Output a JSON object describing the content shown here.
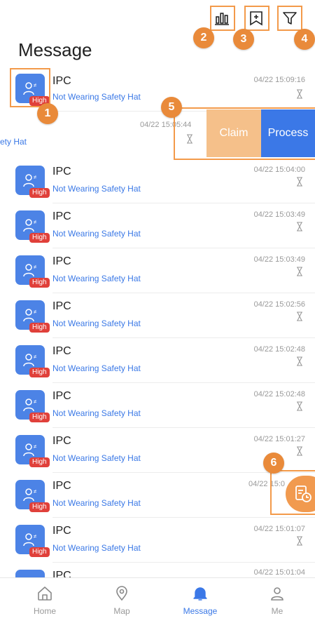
{
  "header": {
    "title": "Message",
    "icons": [
      "statistics-icon",
      "add-bookmark-icon",
      "filter-icon"
    ]
  },
  "callouts": [
    "1",
    "2",
    "3",
    "4",
    "5",
    "6"
  ],
  "swipe_row": {
    "event_fragment": "ety Hat",
    "time": "04/22 15:05:44",
    "claim_label": "Claim",
    "process_label": "Process"
  },
  "messages": [
    {
      "name": "IPC",
      "event": "Not Wearing Safety Hat",
      "time": "04/22 15:09:16",
      "severity": "High"
    },
    {
      "name": "IPC",
      "event": "Not Wearing Safety Hat",
      "time": "04/22 15:04:00",
      "severity": "High"
    },
    {
      "name": "IPC",
      "event": "Not Wearing Safety Hat",
      "time": "04/22 15:03:49",
      "severity": "High"
    },
    {
      "name": "IPC",
      "event": "Not Wearing Safety Hat",
      "time": "04/22 15:03:49",
      "severity": "High"
    },
    {
      "name": "IPC",
      "event": "Not Wearing Safety Hat",
      "time": "04/22 15:02:56",
      "severity": "High"
    },
    {
      "name": "IPC",
      "event": "Not Wearing Safety Hat",
      "time": "04/22 15:02:48",
      "severity": "High"
    },
    {
      "name": "IPC",
      "event": "Not Wearing Safety Hat",
      "time": "04/22 15:02:48",
      "severity": "High"
    },
    {
      "name": "IPC",
      "event": "Not Wearing Safety Hat",
      "time": "04/22 15:01:27",
      "severity": "High"
    },
    {
      "name": "IPC",
      "event": "Not Wearing Safety Hat",
      "time": "04/22 15:0",
      "severity": "High"
    },
    {
      "name": "IPC",
      "event": "Not Wearing Safety Hat",
      "time": "04/22 15:01:07",
      "severity": "High"
    },
    {
      "name": "IPC",
      "event": "",
      "time": "04/22 15:01:04",
      "severity": ""
    }
  ],
  "tabs": [
    {
      "label": "Home",
      "icon": "home-icon"
    },
    {
      "label": "Map",
      "icon": "map-pin-icon"
    },
    {
      "label": "Message",
      "icon": "bell-icon",
      "active": true
    },
    {
      "label": "Me",
      "icon": "user-icon"
    }
  ],
  "colors": {
    "accent": "#3B78E7",
    "highlight": "#F39A4A",
    "severity": "#E0403A",
    "claim": "#F5C08A"
  }
}
